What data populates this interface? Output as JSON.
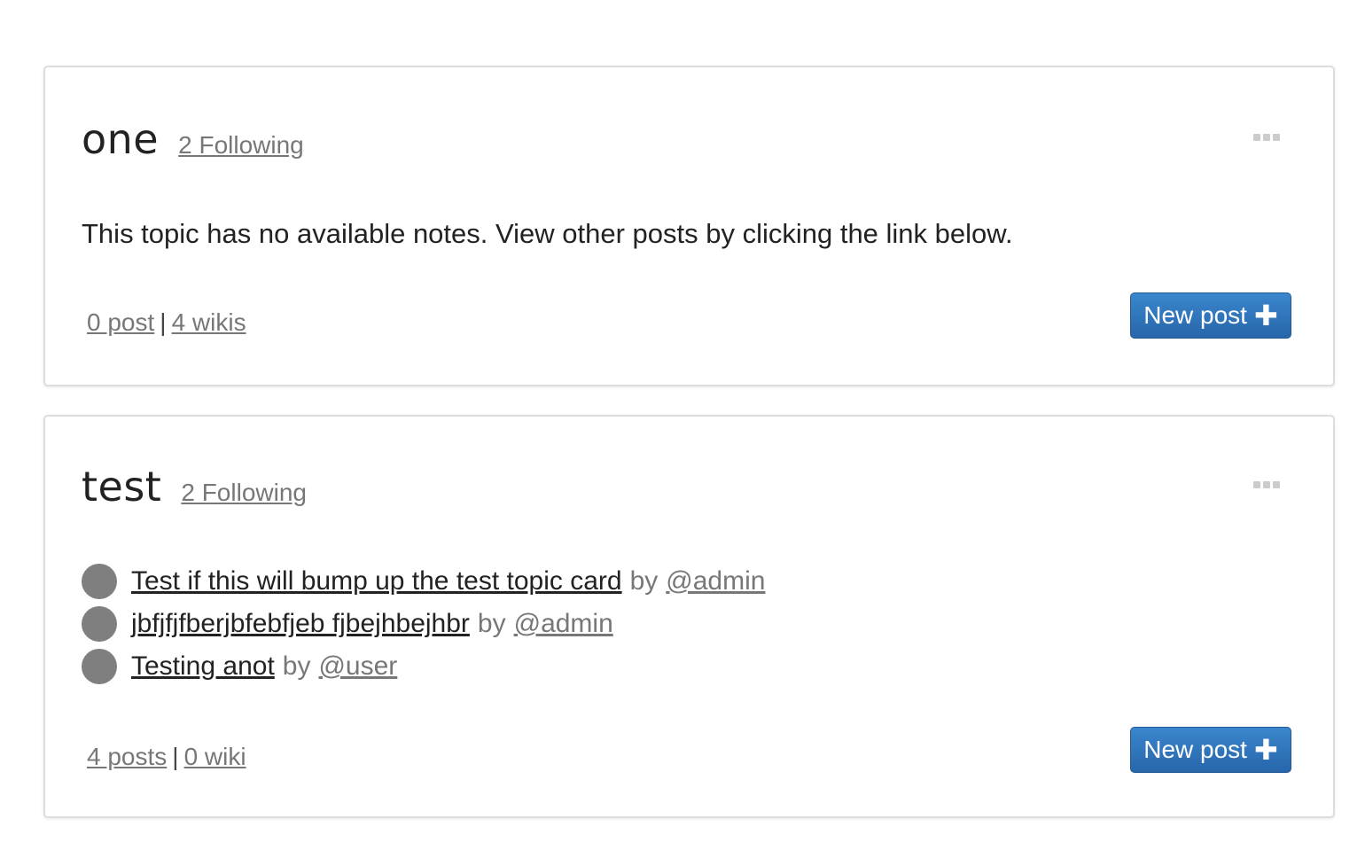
{
  "cards": [
    {
      "title": "one",
      "following": "2 Following",
      "empty_message": "This topic has no available notes. View other posts by clicking the link below.",
      "posts_count": "0 post",
      "separator": "|",
      "wikis_count": "4 wikis",
      "new_post_label": "New post"
    },
    {
      "title": "test",
      "following": "2 Following",
      "posts": [
        {
          "title": "Test if this will bump up the test topic card",
          "by": "by",
          "author": "@admin"
        },
        {
          "title": "jbfjfjfberjbfebfjeb fjbejhbejhbr",
          "by": "by",
          "author": "@admin"
        },
        {
          "title": "Testing anot",
          "by": "by",
          "author": "@user"
        }
      ],
      "posts_count": "4 posts",
      "separator": "|",
      "wikis_count": "0 wiki",
      "new_post_label": "New post"
    }
  ],
  "icons": {
    "menu": "ellipsis-icon",
    "add": "plus-icon",
    "avatar": "avatar"
  },
  "colors": {
    "button": "#2f76bd",
    "link_muted": "#777777",
    "avatar": "#7f7f7f"
  }
}
